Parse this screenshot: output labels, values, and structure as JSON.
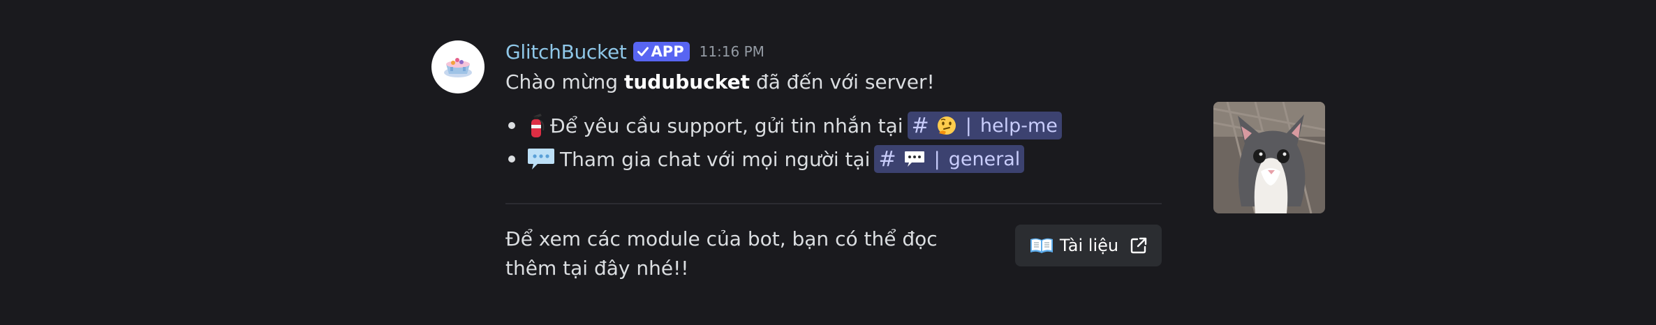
{
  "message": {
    "author": "GlitchBucket",
    "badge": "APP",
    "timestamp": "11:16 PM",
    "welcome": {
      "prefix": "Chào mừng ",
      "user": "tudubucket",
      "suffix": " đã đến với server!"
    },
    "bullets": [
      {
        "icon": "fire-extinguisher-emoji",
        "text": "Để yêu cầu support, gửi tin nhắn tại",
        "channel_icon": "thinking-face-emoji",
        "channel_name": "help-me"
      },
      {
        "icon": "speech-balloon-emoji",
        "text": "Tham gia chat với mọi người tại",
        "channel_icon": "speech-balloon-emoji",
        "channel_name": "general"
      }
    ],
    "channel_hash": "#",
    "channel_separator": "|",
    "thumbnail": "cat-photo",
    "footer_text": "Để xem các module của bot, bạn có thể đọc thêm tại đây nhé!!",
    "docs_button": {
      "label": "Tài liệu",
      "icon": "open-book-emoji",
      "trailing_icon": "external-link-icon"
    }
  },
  "colors": {
    "background": "#1a1a1e",
    "username": "#8fc7e8",
    "badge": "#5865f2",
    "mention_bg": "#3c4270",
    "mention_text": "#c9cdfb"
  }
}
